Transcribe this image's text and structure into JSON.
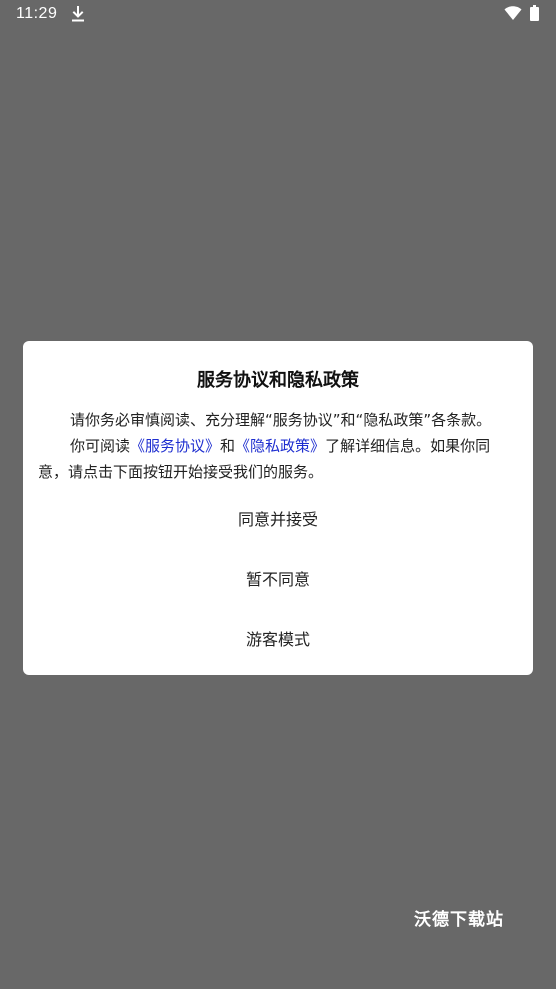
{
  "status_bar": {
    "time": "11:29",
    "download_icon": "download-icon",
    "wifi_icon": "wifi-icon",
    "battery_icon": "battery-icon"
  },
  "dialog": {
    "title": "服务协议和隐私政策",
    "paragraph1": "请你务必审慎阅读、充分理解“服务协议”和“隐私政策”各条款。",
    "paragraph2_prefix": "你可阅读",
    "service_link": "《服务协议》",
    "and_text": "和",
    "privacy_link": "《隐私政策》",
    "paragraph2_suffix": "了解详细信息。如果你同意，请点击下面按钮开始接受我们的服务。",
    "buttons": {
      "agree": "同意并接受",
      "disagree": "暂不同意",
      "guest": "游客模式"
    }
  },
  "watermark": "沃德下载站",
  "colors": {
    "backdrop": "#686868",
    "dialog_bg": "#ffffff",
    "link": "#1f2fd0"
  }
}
